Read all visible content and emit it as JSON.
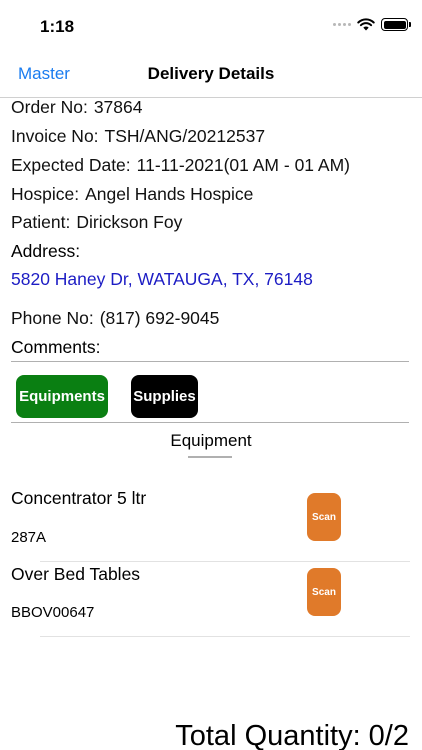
{
  "status_bar": {
    "time": "1:18"
  },
  "nav": {
    "back_label": "Master",
    "title": "Delivery Details"
  },
  "details": {
    "order_label": "Order No:",
    "order_value": "37864",
    "invoice_label": "Invoice No:",
    "invoice_value": "TSH/ANG/20212537",
    "expected_label": "Expected Date:",
    "expected_value": "11-11-2021(01 AM - 01 AM)",
    "hospice_label": "Hospice:",
    "hospice_value": "Angel Hands Hospice",
    "patient_label": "Patient:",
    "patient_value": "Dirickson Foy",
    "address_label": "Address:",
    "address_value": "5820 Haney Dr, WATAUGA, TX, 76148",
    "phone_label": "Phone No:",
    "phone_value": "(817) 692-9045",
    "comments_label": "Comments:"
  },
  "tabs": {
    "equipments": "Equipments",
    "supplies": "Supplies"
  },
  "section": {
    "title": "Equipment"
  },
  "items": [
    {
      "name": "Concentrator 5 ltr",
      "code": "287A",
      "scan_label": "Scan"
    },
    {
      "name": "Over Bed Tables",
      "code": "BBOV00647",
      "scan_label": "Scan"
    }
  ],
  "footer": {
    "total": "Total Quantity: 0/2"
  },
  "colors": {
    "accent_blue": "#1a7cf0",
    "link_blue": "#1d1dc4",
    "equip_green": "#0a7f12",
    "scan_orange": "#e07a2a"
  }
}
